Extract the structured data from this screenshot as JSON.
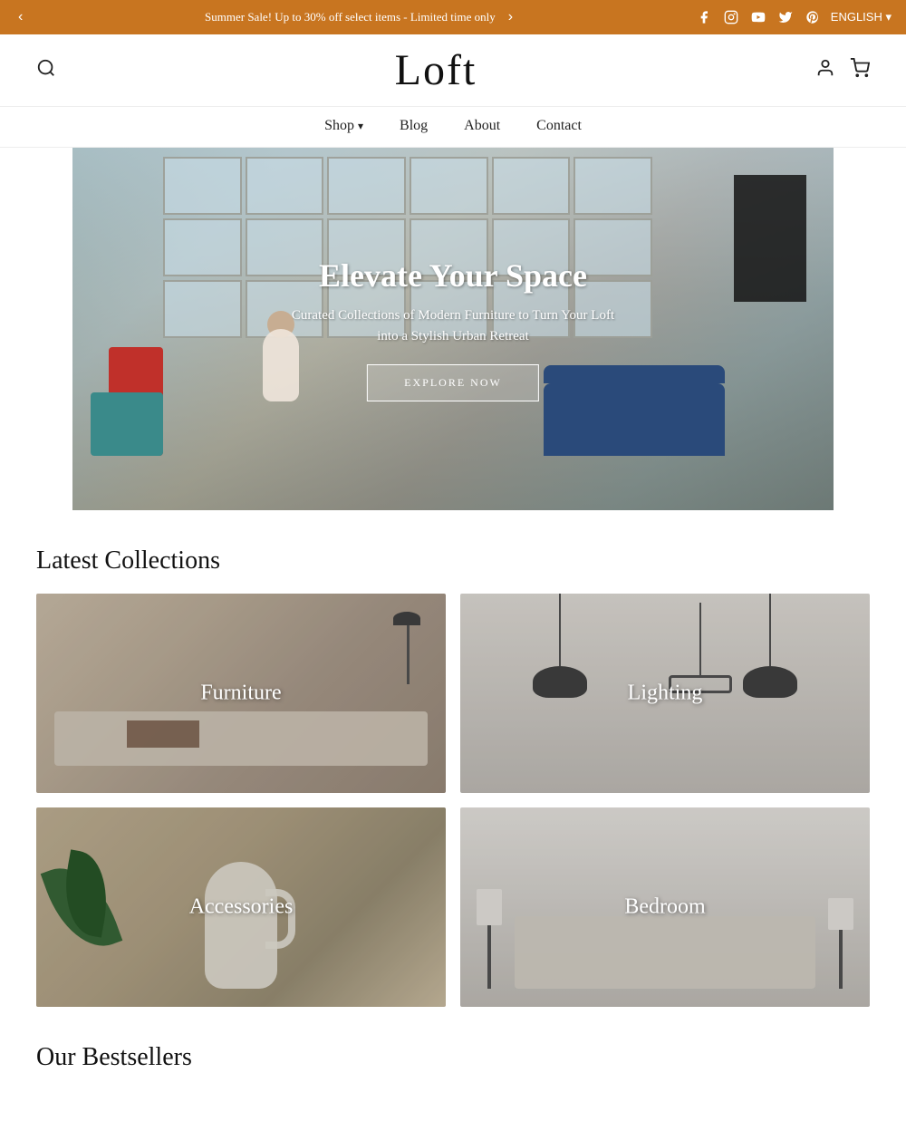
{
  "announcement": {
    "text": "Summer Sale! Up to 30% off select items - Limited time only",
    "prev_label": "‹",
    "next_label": "›",
    "lang": "ENGLISH ▾"
  },
  "social": {
    "facebook": "f",
    "instagram": "◉",
    "youtube": "▶",
    "twitter": "𝕏",
    "pinterest": "𝗣"
  },
  "header": {
    "logo": "Loft",
    "search_icon": "🔍",
    "account_icon": "👤",
    "cart_icon": "🛒"
  },
  "nav": {
    "items": [
      {
        "label": "Shop",
        "has_dropdown": true
      },
      {
        "label": "Blog"
      },
      {
        "label": "About"
      },
      {
        "label": "Contact"
      }
    ]
  },
  "hero": {
    "title": "Elevate Your Space",
    "subtitle": "Curated Collections of Modern Furniture to Turn Your Loft\ninto a Stylish Urban Retreat",
    "cta_label": "EXPLORE NOW"
  },
  "latest_collections": {
    "section_title": "Latest Collections",
    "items": [
      {
        "label": "Furniture"
      },
      {
        "label": "Lighting"
      },
      {
        "label": "Accessories"
      },
      {
        "label": "Bedroom"
      }
    ]
  },
  "bestsellers": {
    "section_title": "Our Bestsellers"
  }
}
